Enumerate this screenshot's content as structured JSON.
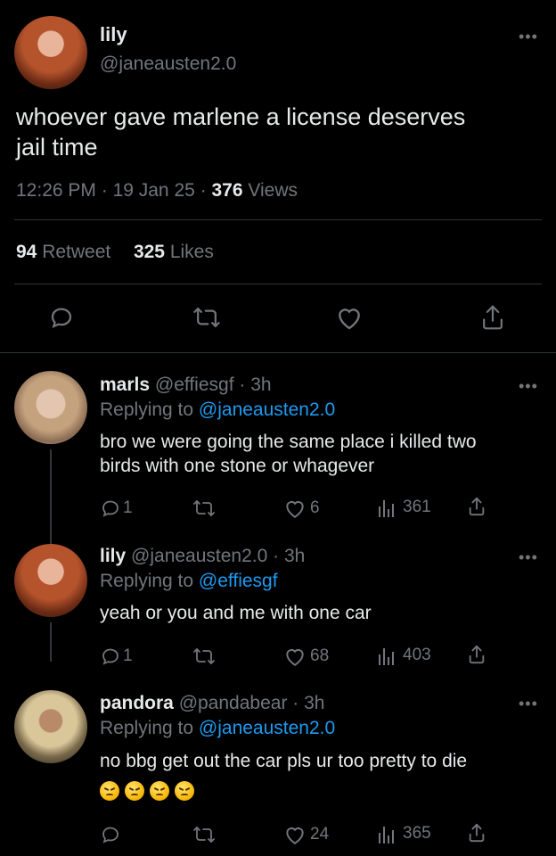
{
  "main_tweet": {
    "name": "lily",
    "handle": "@janeausten2.0",
    "text_line1": "whoever gave marlene a license deserves",
    "text_line2": "jail time",
    "time": "12:26 PM",
    "date": "19 Jan 25",
    "views_count": "376",
    "views_label": "Views",
    "retweets_count": "94",
    "retweets_label": "Retweet",
    "likes_count": "325",
    "likes_label": "Likes"
  },
  "replies": [
    {
      "name": "marls",
      "handle": "@effiesgf",
      "time": "· 3h",
      "replying_prefix": "Replying to",
      "replying_to": "@janeausten2.0",
      "text_line1": "bro we were going the same place i killed two",
      "text_line2": "birds with one stone or whagever",
      "reply_count": "1",
      "like_count": "6",
      "view_count": "361"
    },
    {
      "name": "lily",
      "handle": "@janeausten2.0",
      "time": "· 3h",
      "replying_prefix": "Replying to",
      "replying_to": "@effiesgf",
      "text_line1": "yeah or you and me with one car",
      "reply_count": "1",
      "like_count": "68",
      "view_count": "403"
    },
    {
      "name": "pandora",
      "handle": "@pandabear",
      "time": "· 3h",
      "replying_prefix": "Replying to",
      "replying_to": "@janeausten2.0",
      "text_line1": "no bbg get out the car pls ur too pretty to die",
      "emojis": "😖😖😖😖",
      "like_count": "24",
      "view_count": "365"
    }
  ],
  "colors": {
    "background": "#000000",
    "text": "#e7e9ea",
    "muted": "#71767b",
    "link": "#1d9bf0",
    "divider": "#2f3336"
  },
  "icons": [
    "more-icon",
    "reply-icon",
    "retweet-icon",
    "like-icon",
    "share-icon",
    "views-icon"
  ]
}
